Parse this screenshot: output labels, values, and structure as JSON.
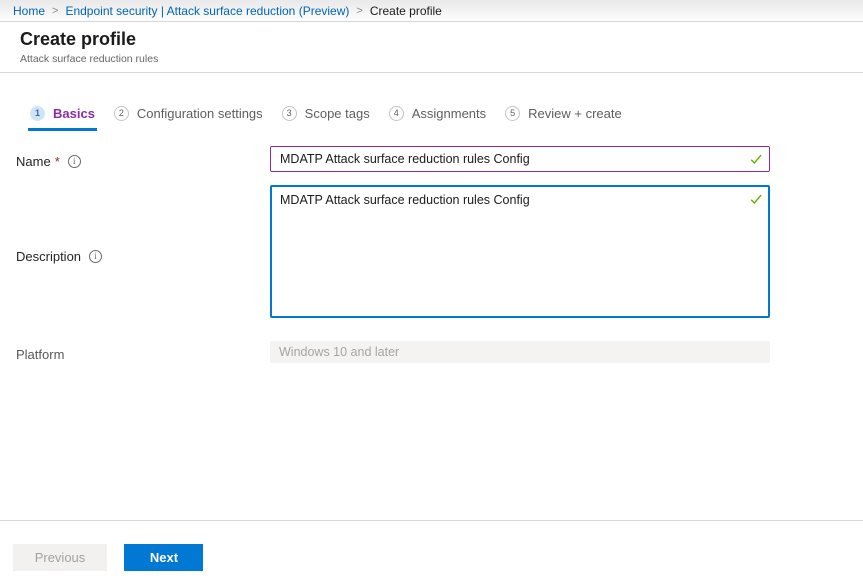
{
  "breadcrumb": {
    "separator": ">",
    "items": [
      {
        "label": "Home"
      },
      {
        "label": "Endpoint security | Attack surface reduction (Preview)"
      },
      {
        "label": "Create profile"
      }
    ]
  },
  "header": {
    "title": "Create profile",
    "subtitle": "Attack surface reduction rules"
  },
  "wizard": {
    "steps": [
      {
        "number": "1",
        "label": "Basics",
        "active": true
      },
      {
        "number": "2",
        "label": "Configuration settings",
        "active": false
      },
      {
        "number": "3",
        "label": "Scope tags",
        "active": false
      },
      {
        "number": "4",
        "label": "Assignments",
        "active": false
      },
      {
        "number": "5",
        "label": "Review + create",
        "active": false
      }
    ]
  },
  "form": {
    "name": {
      "label": "Name",
      "required_marker": "*",
      "value": "MDATP Attack surface reduction rules Config",
      "valid": true
    },
    "description": {
      "label": "Description",
      "value": "MDATP Attack surface reduction rules Config",
      "valid": true
    },
    "platform": {
      "label": "Platform",
      "value": "Windows 10 and later",
      "disabled": true
    }
  },
  "footer": {
    "previous_label": "Previous",
    "next_label": "Next"
  },
  "icons": {
    "info_glyph": "i",
    "check": "checkmark",
    "separator_glyph": ">"
  },
  "colors": {
    "link_blue": "#0065b3",
    "accent_blue": "#0078d4",
    "active_step_purple": "#8a2da5",
    "name_input_border_purple": "#8a2da5",
    "valid_green": "#5db300",
    "required_red": "#a4262c",
    "disabled_bg": "#f3f2f1",
    "disabled_text": "#a19f9d"
  }
}
